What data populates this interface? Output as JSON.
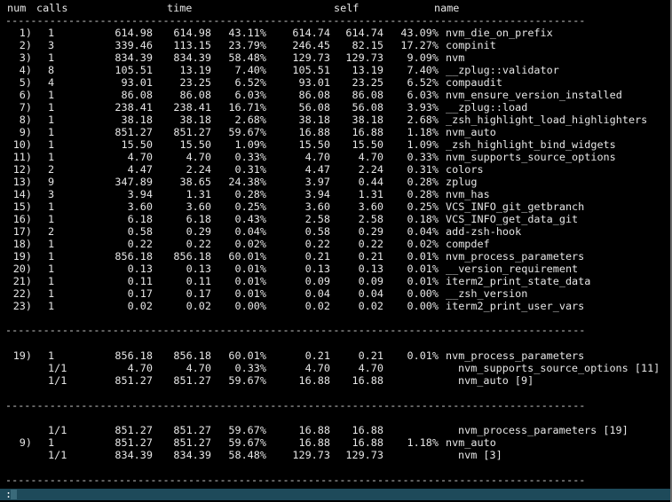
{
  "header": {
    "num": "num",
    "calls": "calls",
    "time": "time",
    "self": "self",
    "name": "name"
  },
  "separator": "--------------------------------------------------------------------------------------------",
  "rows": [
    {
      "num": "1)",
      "calls": "1",
      "t1": "614.98",
      "t2": "614.98",
      "tp": "43.11%",
      "s1": "614.74",
      "s2": "614.74",
      "sp": "43.09%",
      "name": "nvm_die_on_prefix"
    },
    {
      "num": "2)",
      "calls": "3",
      "t1": "339.46",
      "t2": "113.15",
      "tp": "23.79%",
      "s1": "246.45",
      "s2": "82.15",
      "sp": "17.27%",
      "name": "compinit"
    },
    {
      "num": "3)",
      "calls": "1",
      "t1": "834.39",
      "t2": "834.39",
      "tp": "58.48%",
      "s1": "129.73",
      "s2": "129.73",
      "sp": "9.09%",
      "name": "nvm"
    },
    {
      "num": "4)",
      "calls": "8",
      "t1": "105.51",
      "t2": "13.19",
      "tp": "7.40%",
      "s1": "105.51",
      "s2": "13.19",
      "sp": "7.40%",
      "name": "__zplug::validator"
    },
    {
      "num": "5)",
      "calls": "4",
      "t1": "93.01",
      "t2": "23.25",
      "tp": "6.52%",
      "s1": "93.01",
      "s2": "23.25",
      "sp": "6.52%",
      "name": "compaudit"
    },
    {
      "num": "6)",
      "calls": "1",
      "t1": "86.08",
      "t2": "86.08",
      "tp": "6.03%",
      "s1": "86.08",
      "s2": "86.08",
      "sp": "6.03%",
      "name": "nvm_ensure_version_installed"
    },
    {
      "num": "7)",
      "calls": "1",
      "t1": "238.41",
      "t2": "238.41",
      "tp": "16.71%",
      "s1": "56.08",
      "s2": "56.08",
      "sp": "3.93%",
      "name": "__zplug::load"
    },
    {
      "num": "8)",
      "calls": "1",
      "t1": "38.18",
      "t2": "38.18",
      "tp": "2.68%",
      "s1": "38.18",
      "s2": "38.18",
      "sp": "2.68%",
      "name": "_zsh_highlight_load_highlighters"
    },
    {
      "num": "9)",
      "calls": "1",
      "t1": "851.27",
      "t2": "851.27",
      "tp": "59.67%",
      "s1": "16.88",
      "s2": "16.88",
      "sp": "1.18%",
      "name": "nvm_auto"
    },
    {
      "num": "10)",
      "calls": "1",
      "t1": "15.50",
      "t2": "15.50",
      "tp": "1.09%",
      "s1": "15.50",
      "s2": "15.50",
      "sp": "1.09%",
      "name": "_zsh_highlight_bind_widgets"
    },
    {
      "num": "11)",
      "calls": "1",
      "t1": "4.70",
      "t2": "4.70",
      "tp": "0.33%",
      "s1": "4.70",
      "s2": "4.70",
      "sp": "0.33%",
      "name": "nvm_supports_source_options"
    },
    {
      "num": "12)",
      "calls": "2",
      "t1": "4.47",
      "t2": "2.24",
      "tp": "0.31%",
      "s1": "4.47",
      "s2": "2.24",
      "sp": "0.31%",
      "name": "colors"
    },
    {
      "num": "13)",
      "calls": "9",
      "t1": "347.89",
      "t2": "38.65",
      "tp": "24.38%",
      "s1": "3.97",
      "s2": "0.44",
      "sp": "0.28%",
      "name": "zplug"
    },
    {
      "num": "14)",
      "calls": "3",
      "t1": "3.94",
      "t2": "1.31",
      "tp": "0.28%",
      "s1": "3.94",
      "s2": "1.31",
      "sp": "0.28%",
      "name": "nvm_has"
    },
    {
      "num": "15)",
      "calls": "1",
      "t1": "3.60",
      "t2": "3.60",
      "tp": "0.25%",
      "s1": "3.60",
      "s2": "3.60",
      "sp": "0.25%",
      "name": "VCS_INFO_git_getbranch"
    },
    {
      "num": "16)",
      "calls": "1",
      "t1": "6.18",
      "t2": "6.18",
      "tp": "0.43%",
      "s1": "2.58",
      "s2": "2.58",
      "sp": "0.18%",
      "name": "VCS_INFO_get_data_git"
    },
    {
      "num": "17)",
      "calls": "2",
      "t1": "0.58",
      "t2": "0.29",
      "tp": "0.04%",
      "s1": "0.58",
      "s2": "0.29",
      "sp": "0.04%",
      "name": "add-zsh-hook"
    },
    {
      "num": "18)",
      "calls": "1",
      "t1": "0.22",
      "t2": "0.22",
      "tp": "0.02%",
      "s1": "0.22",
      "s2": "0.22",
      "sp": "0.02%",
      "name": "compdef"
    },
    {
      "num": "19)",
      "calls": "1",
      "t1": "856.18",
      "t2": "856.18",
      "tp": "60.01%",
      "s1": "0.21",
      "s2": "0.21",
      "sp": "0.01%",
      "name": "nvm_process_parameters"
    },
    {
      "num": "20)",
      "calls": "1",
      "t1": "0.13",
      "t2": "0.13",
      "tp": "0.01%",
      "s1": "0.13",
      "s2": "0.13",
      "sp": "0.01%",
      "name": "__version_requirement"
    },
    {
      "num": "21)",
      "calls": "1",
      "t1": "0.11",
      "t2": "0.11",
      "tp": "0.01%",
      "s1": "0.09",
      "s2": "0.09",
      "sp": "0.01%",
      "name": "iterm2_print_state_data"
    },
    {
      "num": "22)",
      "calls": "1",
      "t1": "0.17",
      "t2": "0.17",
      "tp": "0.01%",
      "s1": "0.04",
      "s2": "0.04",
      "sp": "0.00%",
      "name": "__zsh_version"
    },
    {
      "num": "23)",
      "calls": "1",
      "t1": "0.02",
      "t2": "0.02",
      "tp": "0.00%",
      "s1": "0.02",
      "s2": "0.02",
      "sp": "0.00%",
      "name": "iterm2_print_user_vars"
    }
  ],
  "detail1": [
    {
      "num": "19)",
      "calls": "1",
      "t1": "856.18",
      "t2": "856.18",
      "tp": "60.01%",
      "s1": "0.21",
      "s2": "0.21",
      "sp": "0.01%",
      "name": "nvm_process_parameters",
      "indent": false
    },
    {
      "num": "",
      "calls": "1/1",
      "t1": "4.70",
      "t2": "4.70",
      "tp": "0.33%",
      "s1": "4.70",
      "s2": "4.70",
      "sp": "",
      "name": "nvm_supports_source_options [11]",
      "indent": true
    },
    {
      "num": "",
      "calls": "1/1",
      "t1": "851.27",
      "t2": "851.27",
      "tp": "59.67%",
      "s1": "16.88",
      "s2": "16.88",
      "sp": "",
      "name": "nvm_auto [9]",
      "indent": true
    }
  ],
  "detail2": [
    {
      "num": "",
      "calls": "1/1",
      "t1": "851.27",
      "t2": "851.27",
      "tp": "59.67%",
      "s1": "16.88",
      "s2": "16.88",
      "sp": "",
      "name": "nvm_process_parameters [19]",
      "indent": true
    },
    {
      "num": "9)",
      "calls": "1",
      "t1": "851.27",
      "t2": "851.27",
      "tp": "59.67%",
      "s1": "16.88",
      "s2": "16.88",
      "sp": "1.18%",
      "name": "nvm_auto",
      "indent": false
    },
    {
      "num": "",
      "calls": "1/1",
      "t1": "834.39",
      "t2": "834.39",
      "tp": "58.48%",
      "s1": "129.73",
      "s2": "129.73",
      "sp": "",
      "name": "nvm [3]",
      "indent": true
    }
  ],
  "status": {
    "prompt": ":"
  }
}
